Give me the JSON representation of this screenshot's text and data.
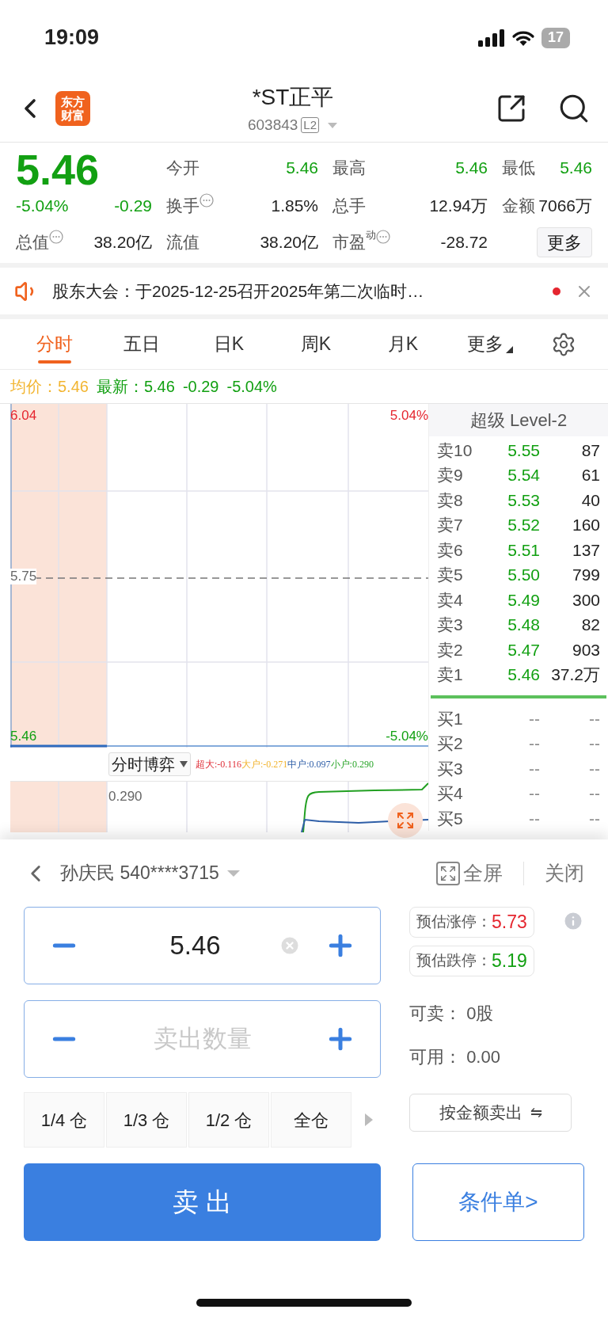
{
  "status_bar": {
    "time": "19:09",
    "battery": "17"
  },
  "header": {
    "logo": "东方财富",
    "title": "*ST正平",
    "code": "603843",
    "badge": "L2"
  },
  "quote": {
    "price": "5.46",
    "change_pct": "-5.04%",
    "change": "-0.29",
    "stats": [
      {
        "label": "今开",
        "value": "5.46",
        "kind": "green"
      },
      {
        "label": "最高",
        "value": "5.46",
        "kind": "green"
      },
      {
        "label": "最低",
        "value": "5.46",
        "kind": "green"
      },
      {
        "label": "换手",
        "value": "1.85%",
        "kind": "info"
      },
      {
        "label": "总手",
        "value": "12.94万",
        "kind": "plain"
      },
      {
        "label": "金额",
        "value": "7066万",
        "kind": "plain"
      },
      {
        "label": "总值",
        "value": "38.20亿",
        "kind": "info"
      },
      {
        "label": "流值",
        "value": "38.20亿",
        "kind": "plain"
      },
      {
        "label": "市盈",
        "sup": "动",
        "value": "-28.72",
        "kind": "info"
      }
    ],
    "more_button": "更多"
  },
  "notice": {
    "text": "股东大会：于2025-12-25召开2025年第二次临时…",
    "unread": true
  },
  "tabs": [
    {
      "label": "分时",
      "selected": true
    },
    {
      "label": "五日",
      "selected": false
    },
    {
      "label": "日K",
      "selected": false
    },
    {
      "label": "周K",
      "selected": false
    },
    {
      "label": "月K",
      "selected": false
    },
    {
      "label": "更多",
      "selected": false,
      "dropdown": true
    }
  ],
  "price_line": {
    "avg_label": "均价：",
    "avg": "5.46",
    "latest_label": "最新：",
    "latest": "5.46",
    "change": "-0.29",
    "change_pct": "-5.04%"
  },
  "chart": {
    "top_price": "6.04",
    "top_pct": "5.04%",
    "mid_price": "5.75",
    "bottom_price": "5.46",
    "bottom_pct": "-5.04%",
    "indicator": "分时博弈",
    "legend": [
      {
        "label": "超大:",
        "value": "-0.116",
        "color": "#e0303a"
      },
      {
        "label": "大户:",
        "value": "-0.271",
        "color": "#f2b531"
      },
      {
        "label": "中户:",
        "value": "0.097",
        "color": "#2f5fa8"
      },
      {
        "label": "小户:",
        "value": "0.290",
        "color": "#2aa52a"
      }
    ],
    "sub_label": "0.290"
  },
  "order_book": {
    "title": "超级 Level-2",
    "asks": [
      {
        "label": "卖10",
        "price": "5.55",
        "volume": "87"
      },
      {
        "label": "卖9",
        "price": "5.54",
        "volume": "61"
      },
      {
        "label": "卖8",
        "price": "5.53",
        "volume": "40"
      },
      {
        "label": "卖7",
        "price": "5.52",
        "volume": "160"
      },
      {
        "label": "卖6",
        "price": "5.51",
        "volume": "137"
      },
      {
        "label": "卖5",
        "price": "5.50",
        "volume": "799"
      },
      {
        "label": "卖4",
        "price": "5.49",
        "volume": "300"
      },
      {
        "label": "卖3",
        "price": "5.48",
        "volume": "82"
      },
      {
        "label": "卖2",
        "price": "5.47",
        "volume": "903"
      },
      {
        "label": "卖1",
        "price": "5.46",
        "volume": "37.2万"
      }
    ],
    "bids": [
      {
        "label": "买1",
        "price": "--",
        "volume": "--"
      },
      {
        "label": "买2",
        "price": "--",
        "volume": "--"
      },
      {
        "label": "买3",
        "price": "--",
        "volume": "--"
      },
      {
        "label": "买4",
        "price": "--",
        "volume": "--"
      },
      {
        "label": "买5",
        "price": "--",
        "volume": "--"
      }
    ]
  },
  "trade": {
    "account": "孙庆民 540****3715",
    "fullscreen": "全屏",
    "close": "关闭",
    "price_value": "5.46",
    "quantity_placeholder": "卖出数量",
    "limit_up": {
      "label": "预估涨停：",
      "value": "5.73"
    },
    "limit_down": {
      "label": "预估跌停：",
      "value": "5.19"
    },
    "sellable": {
      "label": "可卖：",
      "value": "0股"
    },
    "available": {
      "label": "可用：",
      "value": "0.00"
    },
    "positions": [
      "1/4 仓",
      "1/3 仓",
      "1/2 仓",
      "全仓"
    ],
    "amount_button": "按金额卖出",
    "amount_icon": "⇋",
    "sell_button": "卖 出",
    "conditional_button": "条件单>"
  }
}
